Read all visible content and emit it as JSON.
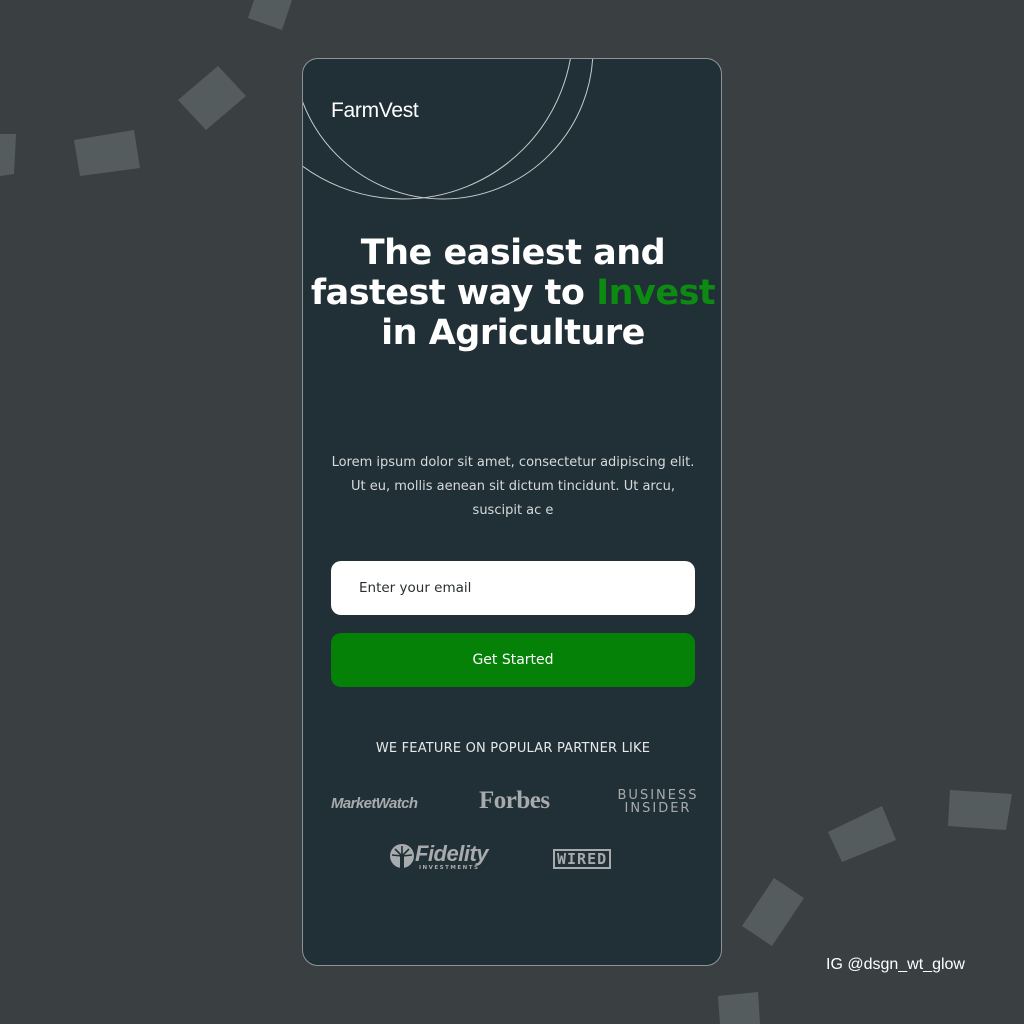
{
  "brand": {
    "name": "FarmVest"
  },
  "hero": {
    "headline_part1": "The easiest and fastest way to ",
    "headline_accent": "Invest",
    "headline_part2": " in Agriculture",
    "description": "Lorem ipsum dolor sit amet, consectetur adipiscing elit. Ut eu, mollis aenean sit dictum tincidunt. Ut arcu, suscipit ac e"
  },
  "form": {
    "email_placeholder": "Enter your email",
    "cta_label": "Get Started"
  },
  "partners": {
    "title": "WE FEATURE ON POPULAR PARTNER LIKE",
    "logos": {
      "marketwatch": "MarketWatch",
      "forbes": "Forbes",
      "business_insider_line1": "BUSINESS",
      "business_insider_line2": "INSIDER",
      "fidelity": "Fidelity",
      "fidelity_sub": "INVESTMENTS",
      "wired": "WIRED"
    }
  },
  "watermark": "IG @dsgn_wt_glow",
  "colors": {
    "background": "#3a4042",
    "card": "#212f36",
    "accent_green": "#058108",
    "invest_text": "#0c8a12",
    "logo_gray": "#a7abad"
  },
  "icons": [
    "fidelity-torch-icon"
  ]
}
